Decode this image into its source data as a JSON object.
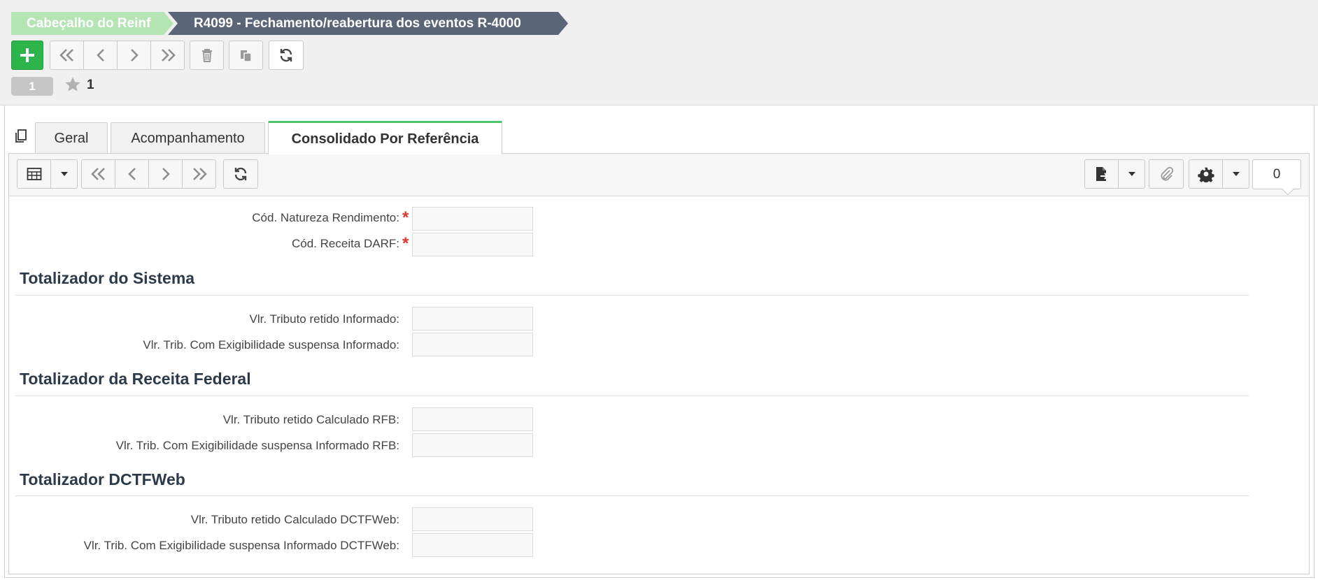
{
  "breadcrumb": {
    "parent": "Cabeçalho do Reinf",
    "current": "R4099 - Fechamento/reabertura dos eventos R-4000"
  },
  "record": {
    "number": "1",
    "favorites_count": "1"
  },
  "tabs": [
    {
      "label": "Geral"
    },
    {
      "label": "Acompanhamento"
    },
    {
      "label": "Consolidado Por Referência"
    }
  ],
  "inner_toolbar": {
    "counter": "0"
  },
  "form": {
    "top_fields": [
      {
        "label": "Cód. Natureza Rendimento:",
        "value": "",
        "required": true
      },
      {
        "label": "Cód. Receita DARF:",
        "value": "",
        "required": true
      }
    ],
    "sections": [
      {
        "title": "Totalizador do Sistema",
        "fields": [
          {
            "label": "Vlr. Tributo retido Informado:",
            "value": ""
          },
          {
            "label": "Vlr. Trib. Com Exigibilidade suspensa Informado:",
            "value": ""
          }
        ]
      },
      {
        "title": "Totalizador da Receita Federal",
        "fields": [
          {
            "label": "Vlr. Tributo retido Calculado RFB:",
            "value": ""
          },
          {
            "label": "Vlr. Trib. Com Exigibilidade suspensa Informado RFB:",
            "value": ""
          }
        ]
      },
      {
        "title": "Totalizador DCTFWeb",
        "fields": [
          {
            "label": "Vlr. Tributo retido Calculado DCTFWeb:",
            "value": ""
          },
          {
            "label": "Vlr. Trib. Com Exigibilidade suspensa Informado DCTFWeb:",
            "value": ""
          }
        ]
      }
    ]
  },
  "icons": {
    "add": "plus-icon",
    "first": "double-chevron-left-icon",
    "prev": "chevron-left-icon",
    "next": "chevron-right-icon",
    "last": "double-chevron-right-icon",
    "delete": "trash-icon",
    "copy": "copy-icon",
    "refresh": "refresh-icon",
    "favorite": "star-icon",
    "grid": "table-grid-icon",
    "export": "file-export-icon",
    "attach": "paperclip-icon",
    "settings": "gear-icon",
    "dropdown": "caret-down-icon",
    "clone": "clone-icon"
  },
  "colors": {
    "add_button": "#2db44a",
    "active_tab_accent": "#4cc46a",
    "breadcrumb_parent": "#b5e4b5",
    "breadcrumb_current": "#5a6678",
    "required_marker": "#e0372c"
  }
}
